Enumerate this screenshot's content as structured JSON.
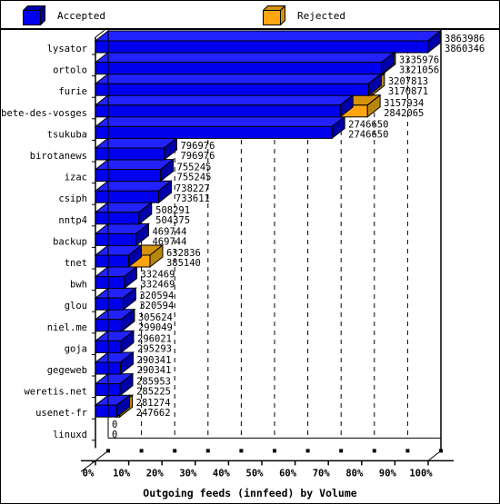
{
  "legend": {
    "accepted_label": "Accepted",
    "rejected_label": "Rejected",
    "accepted_color": "#0000EE",
    "rejected_color": "#FFA510"
  },
  "axis": {
    "x_title": "Outgoing feeds (innfeed) by Volume",
    "x_ticks": [
      "0%",
      "10%",
      "20%",
      "30%",
      "40%",
      "50%",
      "60%",
      "70%",
      "80%",
      "90%",
      "100%"
    ]
  },
  "chart_data": {
    "type": "bar",
    "orientation": "horizontal",
    "title": "",
    "subtitle": "",
    "xlabel": "Outgoing feeds (innfeed) by Volume",
    "ylabel": "",
    "xlim": [
      0,
      100
    ],
    "xtick_labels": [
      "0%",
      "10%",
      "20%",
      "30%",
      "40%",
      "50%",
      "60%",
      "70%",
      "80%",
      "90%",
      "100%"
    ],
    "xtick_values": [
      0,
      10,
      20,
      30,
      40,
      50,
      60,
      70,
      80,
      90,
      100
    ],
    "grid": true,
    "legend_position": "top",
    "units": "volume (bytes)",
    "max_value": 3863986,
    "categories": [
      "lysator",
      "ortolo",
      "furie",
      "bete-des-vosges",
      "tsukuba",
      "birotanews",
      "izac",
      "csiph",
      "nntp4",
      "backup",
      "tnet",
      "bwh",
      "glou",
      "niel.me",
      "goja",
      "gegeweb",
      "weretis.net",
      "usenet-fr",
      "linuxd"
    ],
    "series": [
      {
        "name": "Accepted",
        "color": "#0000EE",
        "values": [
          3863986,
          3335976,
          3207813,
          3157934,
          2746650,
          796976,
          755245,
          738227,
          508291,
          469744,
          632836,
          332469,
          320594,
          305624,
          296021,
          290341,
          285953,
          281274,
          0
        ]
      },
      {
        "name": "Rejected",
        "color": "#FFA510",
        "values": [
          3860346,
          3321056,
          3170871,
          2842065,
          2746650,
          796976,
          755245,
          733611,
          504375,
          469744,
          385140,
          332469,
          320594,
          299049,
          295293,
          290341,
          285225,
          247662,
          0
        ]
      }
    ],
    "rows": [
      {
        "label": "lysator",
        "accepted": 3863986,
        "rejected": 3860346
      },
      {
        "label": "ortolo",
        "accepted": 3335976,
        "rejected": 3321056
      },
      {
        "label": "furie",
        "accepted": 3207813,
        "rejected": 3170871
      },
      {
        "label": "bete-des-vosges",
        "accepted": 3157934,
        "rejected": 2842065
      },
      {
        "label": "tsukuba",
        "accepted": 2746650,
        "rejected": 2746650
      },
      {
        "label": "birotanews",
        "accepted": 796976,
        "rejected": 796976
      },
      {
        "label": "izac",
        "accepted": 755245,
        "rejected": 755245
      },
      {
        "label": "csiph",
        "accepted": 738227,
        "rejected": 733611
      },
      {
        "label": "nntp4",
        "accepted": 508291,
        "rejected": 504375
      },
      {
        "label": "backup",
        "accepted": 469744,
        "rejected": 469744
      },
      {
        "label": "tnet",
        "accepted": 632836,
        "rejected": 385140
      },
      {
        "label": "bwh",
        "accepted": 332469,
        "rejected": 332469
      },
      {
        "label": "glou",
        "accepted": 320594,
        "rejected": 320594
      },
      {
        "label": "niel.me",
        "accepted": 305624,
        "rejected": 299049
      },
      {
        "label": "goja",
        "accepted": 296021,
        "rejected": 295293
      },
      {
        "label": "gegeweb",
        "accepted": 290341,
        "rejected": 290341
      },
      {
        "label": "weretis.net",
        "accepted": 285953,
        "rejected": 285225
      },
      {
        "label": "usenet-fr",
        "accepted": 281274,
        "rejected": 247662
      },
      {
        "label": "linuxd",
        "accepted": 0,
        "rejected": 0
      }
    ]
  },
  "colors": {
    "bar_blue_front": "#0000EE",
    "bar_blue_dark": "#0000A8",
    "bar_blue_top": "#2222FF",
    "bar_orange_front": "#FFA510",
    "bar_orange_dark": "#B8860B",
    "bar_orange_top": "#D4920A",
    "background": "#FFFFFF",
    "outline": "#000000"
  }
}
